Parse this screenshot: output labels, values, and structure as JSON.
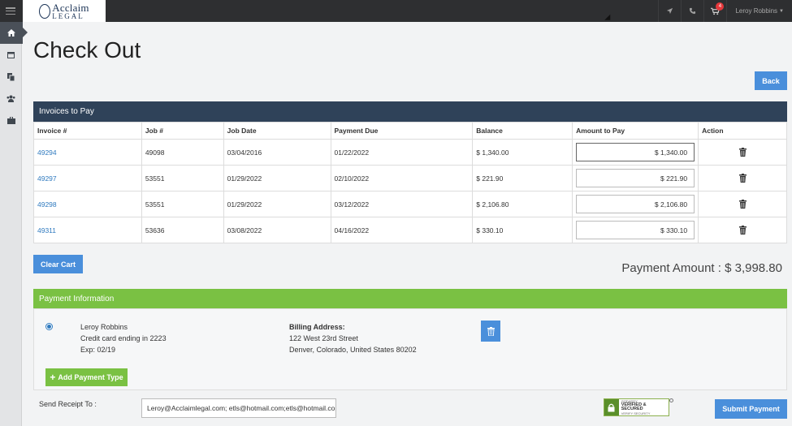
{
  "app": {
    "logo_text_1": "Acclaim",
    "logo_text_2": "LEGAL"
  },
  "topbar": {
    "cart_count": "4",
    "user_name": "Leroy Robbins"
  },
  "sidebar": {
    "items": [
      {
        "icon": "home-icon"
      },
      {
        "icon": "calendar-icon"
      },
      {
        "icon": "documents-icon"
      },
      {
        "icon": "users-icon"
      },
      {
        "icon": "briefcase-icon"
      }
    ]
  },
  "page": {
    "title": "Check Out",
    "back_label": "Back"
  },
  "invoices": {
    "heading": "Invoices to Pay",
    "columns": [
      "Invoice #",
      "Job #",
      "Job Date",
      "Payment Due",
      "Balance",
      "Amount to Pay",
      "Action"
    ],
    "rows": [
      {
        "invoice": "49294",
        "job": "49098",
        "job_date": "03/04/2016",
        "due": "01/22/2022",
        "balance": "$ 1,340.00",
        "amount": "$ 1,340.00"
      },
      {
        "invoice": "49297",
        "job": "53551",
        "job_date": "01/29/2022",
        "due": "02/10/2022",
        "balance": "$ 221.90",
        "amount": "$ 221.90"
      },
      {
        "invoice": "49298",
        "job": "53551",
        "job_date": "01/29/2022",
        "due": "03/12/2022",
        "balance": "$ 2,106.80",
        "amount": "$ 2,106.80"
      },
      {
        "invoice": "49311",
        "job": "53636",
        "job_date": "03/08/2022",
        "due": "04/16/2022",
        "balance": "$ 330.10",
        "amount": "$ 330.10"
      }
    ],
    "clear_label": "Clear Cart"
  },
  "payment_amount": "Payment Amount : $ 3,998.80",
  "payment": {
    "heading": "Payment Information",
    "card": {
      "name": "Leroy Robbins",
      "ending": "Credit card ending in 2223",
      "exp": "Exp: 02/19"
    },
    "billing": {
      "label": "Billing Address:",
      "line1": "122 West 23rd Street",
      "line2": "Denver, Colorado, United States 80202"
    },
    "add_label": "Add Payment Type"
  },
  "receipt": {
    "label": "Send Receipt To :",
    "value": "Leroy@Acclaimlegal.com; etls@hotmail.com;etls@hotmail.com"
  },
  "seal": {
    "line1": "GODADDY",
    "line2": "VERIFIED & SECURED",
    "line3": "VERIFY SECURITY"
  },
  "submit_label": "Submit Payment"
}
